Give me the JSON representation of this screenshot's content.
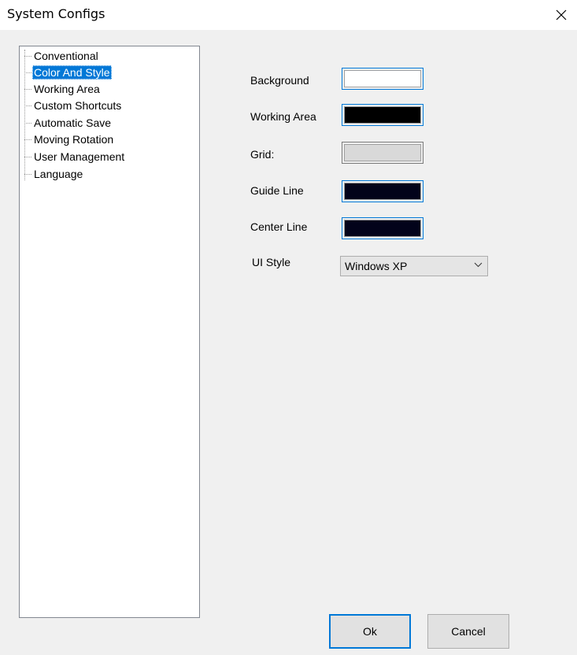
{
  "window": {
    "title": "System Configs"
  },
  "tree": {
    "items": [
      {
        "label": "Conventional",
        "selected": false
      },
      {
        "label": "Color And Style",
        "selected": true
      },
      {
        "label": "Working Area",
        "selected": false
      },
      {
        "label": "Custom Shortcuts",
        "selected": false
      },
      {
        "label": "Automatic Save",
        "selected": false
      },
      {
        "label": "Moving Rotation",
        "selected": false
      },
      {
        "label": "User Management",
        "selected": false
      },
      {
        "label": "Language",
        "selected": false
      }
    ]
  },
  "colors": {
    "background": {
      "label": "Background",
      "value": "#ffffff"
    },
    "working_area": {
      "label": "Working Area",
      "value": "#000000"
    },
    "grid": {
      "label": "Grid:",
      "value": "#d9d9d9"
    },
    "guide_line": {
      "label": "Guide Line",
      "value": "#02031a"
    },
    "center_line": {
      "label": "Center Line",
      "value": "#02031a"
    }
  },
  "ui_style": {
    "label": "UI Style",
    "value": "Windows XP"
  },
  "buttons": {
    "ok": "Ok",
    "cancel": "Cancel"
  },
  "theme": {
    "accent": "#0078d7",
    "panel": "#f0f0f0"
  }
}
